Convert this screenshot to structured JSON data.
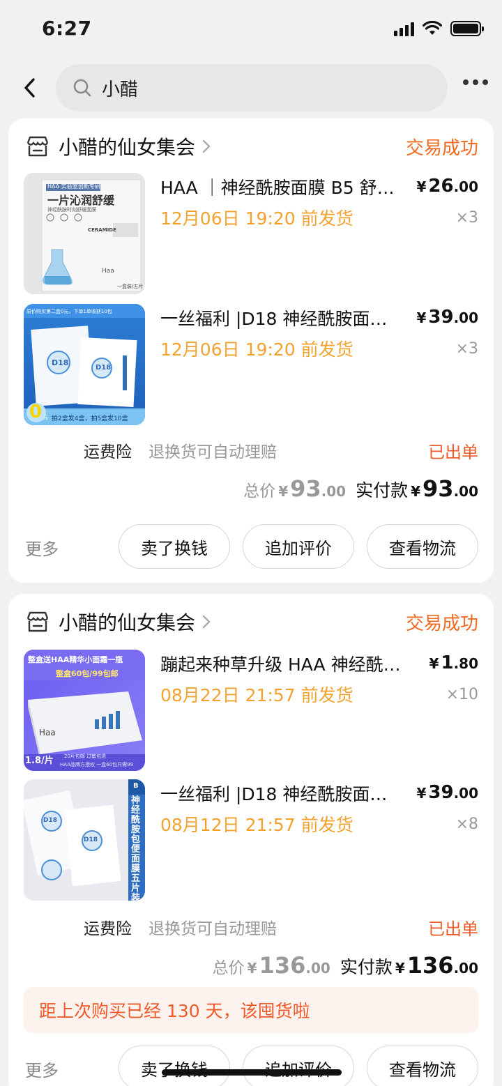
{
  "status_bar": {
    "time": "6:27"
  },
  "search": {
    "query": "小醋"
  },
  "orders": [
    {
      "shop_name": "小醋的仙女集会",
      "status": "交易成功",
      "items": [
        {
          "title": "HAA ｜神经酰胺面膜 B5 舒缓修护",
          "ship_time": "12月06日 19:20 前发货",
          "price_int": "26",
          "price_dec": ".00",
          "qty": "×3",
          "thumb": {
            "badge": "HAA 实验室创新专研",
            "headline": "一片沁润舒缓",
            "sub": "神经酰胺时刻舒缓面膜",
            "brand": "CERAMIDE",
            "logo": "Haa",
            "pack": "一盒装/五片"
          }
        },
        {
          "title": "一丝福利 |D18 神经酰胺面膜修护",
          "ship_time": "12月06日 19:20 前发货",
          "price_int": "39",
          "price_dec": ".00",
          "qty": "×3",
          "thumb": {
            "top_text": "原价购买第二盒0元，下单1单收获10包",
            "label": "D18",
            "zero": "0",
            "yuan": "元",
            "promo": "拍2盒发4盒，拍5盒发10盒"
          }
        }
      ],
      "service": {
        "name": "运费险",
        "desc": "退换货可自动理赔",
        "delivery_status": "已出单"
      },
      "total": {
        "label": "总价",
        "yen": "¥",
        "int": "93",
        "dec": ".00"
      },
      "paid": {
        "label": "实付款",
        "yen": "¥",
        "int": "93",
        "dec": ".00"
      },
      "actions": {
        "more": "更多",
        "sell": "卖了换钱",
        "review": "追加评价",
        "logistics": "查看物流"
      }
    },
    {
      "shop_name": "小醋的仙女集会",
      "status": "交易成功",
      "items": [
        {
          "title": "蹦起来种草升级 HAA 神经酰胺面膜",
          "ship_time": "08月22日 21:57 前发货",
          "price_int": "1",
          "price_dec": ".80",
          "qty": "×10",
          "thumb": {
            "banner": "整盒送HAA精华小面霜一瓶",
            "sub": "整盒60包/99包邮",
            "logo": "Haa",
            "per_piece": "1.8/片",
            "foot1": "20片包邮 过敏包退",
            "foot2": "HAA品牌方授权 一盒60包只需99"
          }
        },
        {
          "title": "一丝福利 |D18 神经酰胺面膜修护",
          "ship_time": "08月12日 21:57 前发货",
          "price_int": "39",
          "price_dec": ".00",
          "qty": "×8",
          "thumb": {
            "label": "D18",
            "side": "神经酰胺包便面膜五片装",
            "logo": "B"
          }
        }
      ],
      "service": {
        "name": "运费险",
        "desc": "退换货可自动理赔",
        "delivery_status": "已出单"
      },
      "total": {
        "label": "总价",
        "yen": "¥",
        "int": "136",
        "dec": ".00"
      },
      "paid": {
        "label": "实付款",
        "yen": "¥",
        "int": "136",
        "dec": ".00"
      },
      "reminder": "距上次购买已经 130 天，该囤货啦",
      "actions": {
        "more": "更多",
        "sell": "卖了换钱",
        "review": "追加评价",
        "logistics": "查看物流"
      }
    }
  ],
  "colors": {
    "accent": "#ef6a1f",
    "ship_time": "#f3a230",
    "background": "#f1f1f3"
  },
  "icons": [
    "back-arrow-icon",
    "search-icon",
    "more-dots-icon",
    "shop-icon",
    "chevron-right-icon",
    "signal-icon",
    "wifi-icon",
    "battery-icon"
  ]
}
